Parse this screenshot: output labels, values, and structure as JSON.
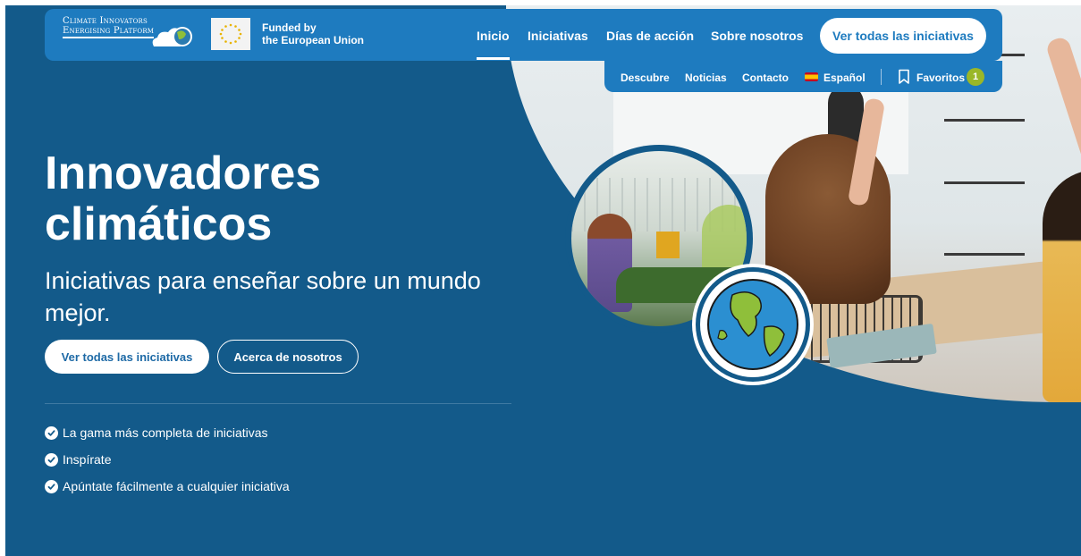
{
  "colors": {
    "hero_bg": "#135a8a",
    "nav_bg": "#1e7bbf",
    "accent_badge": "#9ab728",
    "text_light": "#ffffff"
  },
  "header": {
    "logo_line1": "Climate Innovators",
    "logo_line2": "Energising Platform",
    "eu_line1": "Funded by",
    "eu_line2": "the European Union",
    "nav": [
      "Inicio",
      "Iniciativas",
      "Días de acción",
      "Sobre nosotros"
    ],
    "active_nav": "Inicio",
    "cta": "Ver todas las iniciativas"
  },
  "subnav": {
    "items": [
      "Descubre",
      "Noticias",
      "Contacto"
    ],
    "language": "Español",
    "favorites": "Favoritos",
    "favorites_count": "1"
  },
  "hero": {
    "title_line1": "Innovadores",
    "title_line2": "climáticos",
    "subtitle": "Iniciativas para enseñar sobre un mundo mejor.",
    "primary_button": "Ver todas las iniciativas",
    "secondary_button": "Acerca de nosotros",
    "features": [
      "La gama más completa de iniciativas",
      "Inspírate",
      "Apúntate fácilmente a cualquier iniciativa"
    ]
  },
  "icons": [
    "logo-cloud-globe-icon",
    "eu-flag-icon",
    "spain-flag-icon",
    "bookmark-icon",
    "check-circle-icon",
    "globe-illustration-icon"
  ]
}
